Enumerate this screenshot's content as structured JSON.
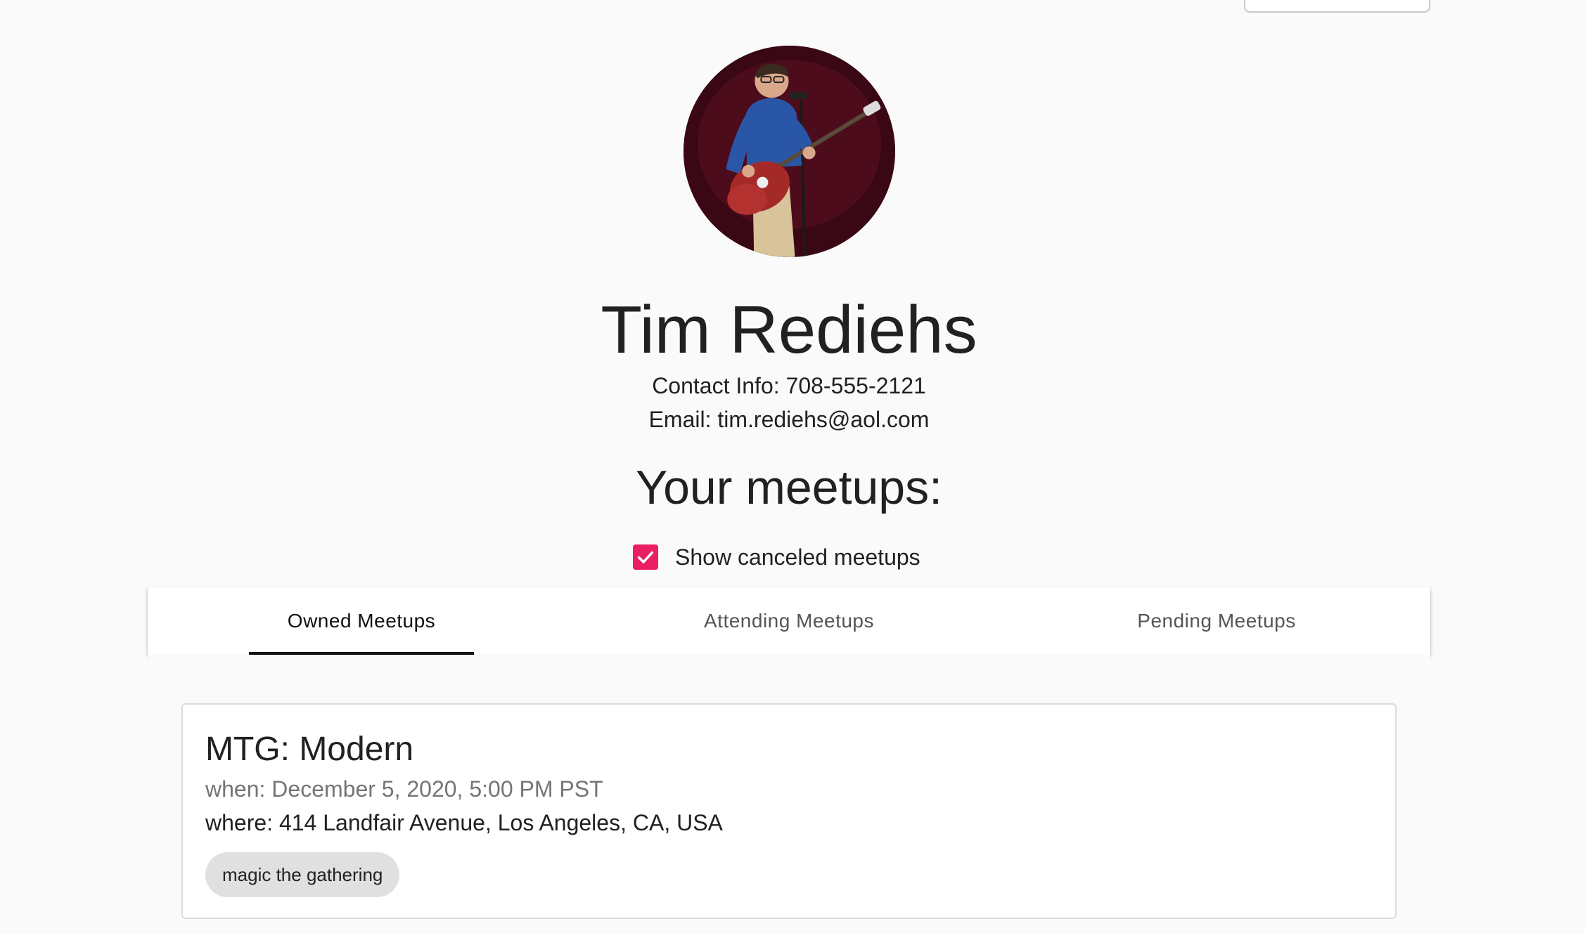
{
  "profile": {
    "name": "Tim Rediehs",
    "contact_info": "Contact Info: 708-555-2121",
    "email": "Email: tim.rediehs@aol.com"
  },
  "meetups_section": {
    "title": "Your meetups:",
    "show_canceled_label": "Show canceled meetups",
    "show_canceled_checked": true
  },
  "tabs": [
    {
      "label": "Owned Meetups",
      "active": true
    },
    {
      "label": "Attending Meetups",
      "active": false
    },
    {
      "label": "Pending Meetups",
      "active": false
    }
  ],
  "meetups": [
    {
      "title": "MTG: Modern",
      "when": "when: December 5, 2020, 5:00 PM PST",
      "where": "where: 414 Landfair Avenue, Los Angeles, CA, USA",
      "tags": [
        "magic the gathering"
      ]
    }
  ],
  "colors": {
    "accent": "#e91e63",
    "background": "#fafafa",
    "tab_indicator": "#111111",
    "chip": "#e0e0e0"
  },
  "icons": {
    "checkbox": "check-icon"
  }
}
